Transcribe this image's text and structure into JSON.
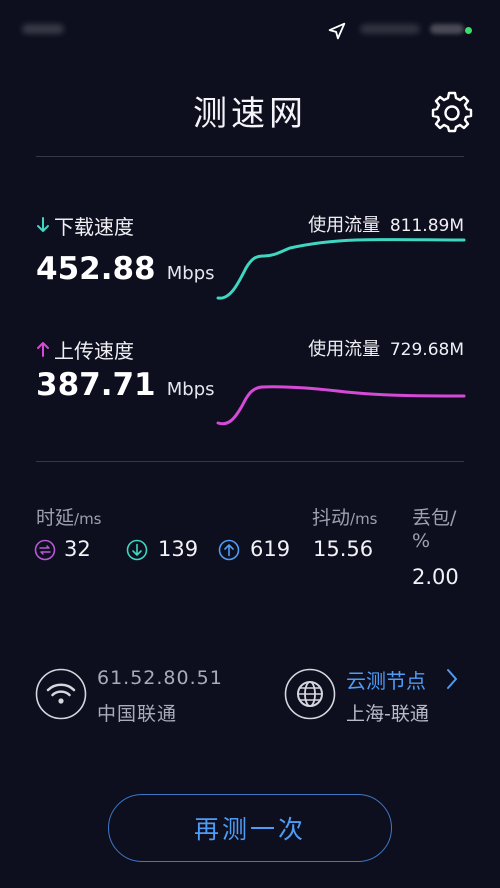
{
  "app": {
    "title": "测速网"
  },
  "download": {
    "label": "下载速度",
    "value": "452.88",
    "unit": "Mbps",
    "usage_label": "使用流量",
    "usage_value": "811.89M",
    "color": "#3fd6c2"
  },
  "upload": {
    "label": "上传速度",
    "value": "387.71",
    "unit": "Mbps",
    "usage_label": "使用流量",
    "usage_value": "729.68M",
    "color": "#d64ad8"
  },
  "metrics": {
    "latency_label": "时延",
    "latency_unit": "/ms",
    "latency_value": "32",
    "latency_down": "139",
    "latency_up": "619",
    "jitter_label": "抖动",
    "jitter_unit": "/ms",
    "jitter_value": "15.56",
    "loss_label": "丢包/",
    "loss_unit": "%",
    "loss_value": "2.00"
  },
  "network": {
    "ip": "61.52.80.51",
    "isp": "中国联通",
    "node_link": "云测节点",
    "node": "上海-联通"
  },
  "actions": {
    "retest": "再测一次"
  },
  "colors": {
    "background": "#0d0e1e",
    "accent": "#4f9cf5"
  }
}
